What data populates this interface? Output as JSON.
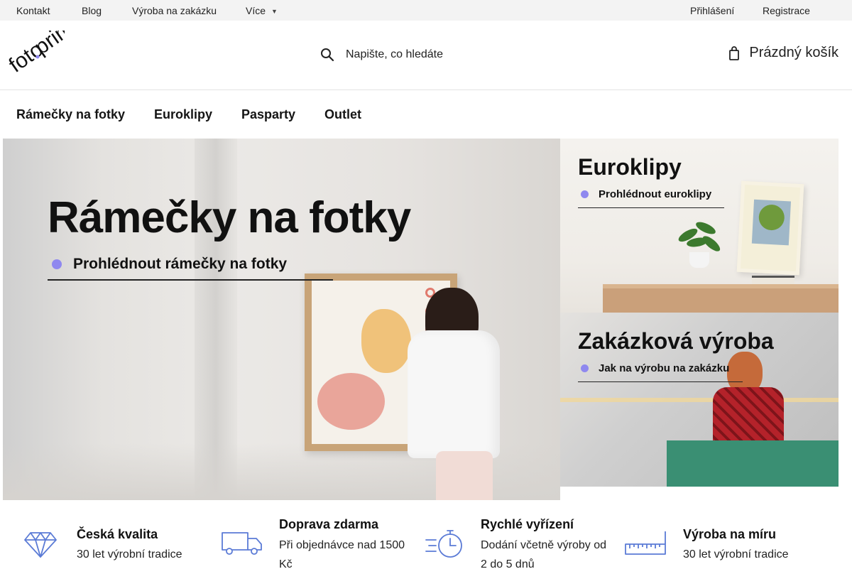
{
  "topbar": {
    "links": [
      "Kontakt",
      "Blog",
      "Výroba na zakázku",
      "Více"
    ],
    "more_caret": "▼",
    "auth": {
      "login": "Přihlášení",
      "register": "Registrace"
    }
  },
  "header": {
    "logo_text": "fotoprim",
    "logo_icon": "logo",
    "search_placeholder": "Napište, co hledáte",
    "search_icon": "search-icon",
    "cart_label": "Prázdný košík",
    "cart_icon": "cart-icon"
  },
  "main_nav": [
    "Rámečky na fotky",
    "Euroklipy",
    "Pasparty",
    "Outlet"
  ],
  "banners": {
    "main": {
      "title": "Rámečky na fotky",
      "link": "Prohlédnout rámečky na fotky"
    },
    "top_right": {
      "title": "Euroklipy",
      "link": "Prohlédnout euroklipy"
    },
    "bottom_right": {
      "title": "Zakázková výroba",
      "link": "Jak na výrobu na zakázku"
    },
    "accent_color": "#8f88ef"
  },
  "features": [
    {
      "icon": "diamond-icon",
      "title": "Česká kvalita",
      "desc": "30 let výrobní tradice"
    },
    {
      "icon": "truck-icon",
      "title": "Doprava zdarma",
      "desc": "Při objednávce nad 1500 Kč"
    },
    {
      "icon": "stopwatch-icon",
      "title": "Rychlé vyřízení",
      "desc": "Dodání včetně výroby od 2 do 5 dnů"
    },
    {
      "icon": "ruler-icon",
      "title": "Výroba na míru",
      "desc": "30 let výrobní tradice"
    }
  ],
  "icon_color": "#5b7bd6"
}
